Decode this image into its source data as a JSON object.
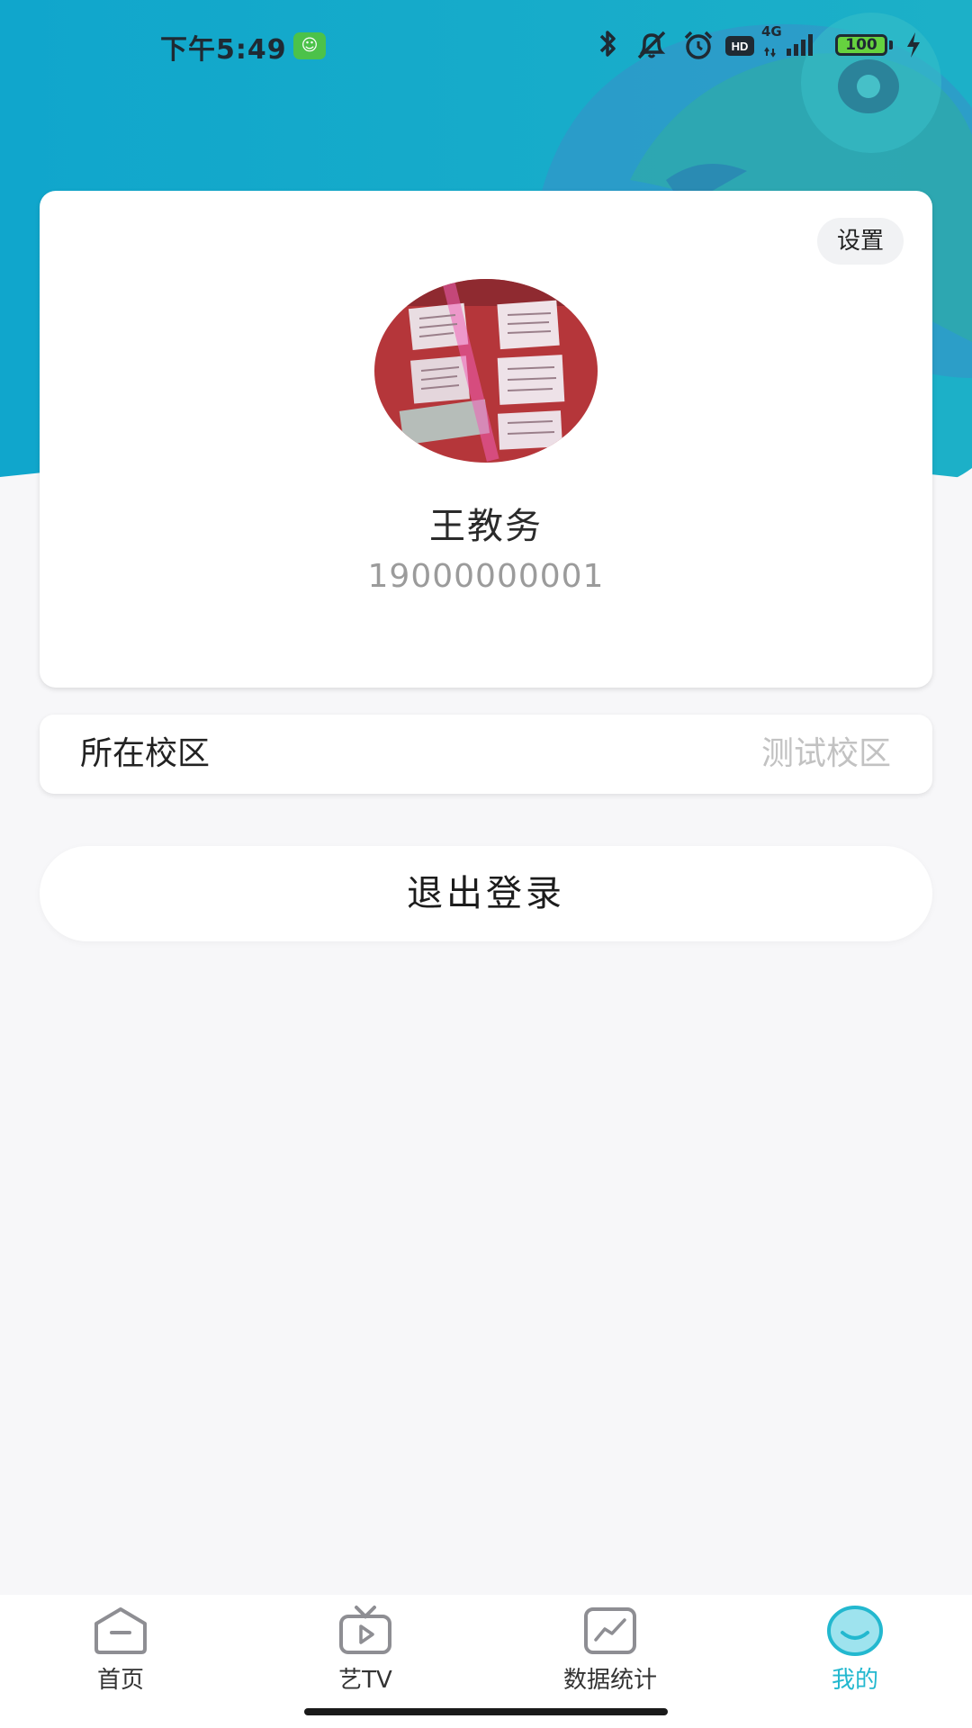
{
  "status_bar": {
    "time": "下午5:49",
    "network": "4G",
    "battery": "100"
  },
  "profile": {
    "settings_label": "设置",
    "name": "王教务",
    "phone": "19000000001"
  },
  "campus": {
    "label": "所在校区",
    "value": "测试校区"
  },
  "logout_label": "退出登录",
  "tabs": [
    {
      "label": "首页",
      "icon": "home-icon",
      "active": false
    },
    {
      "label": "艺TV",
      "icon": "tv-icon",
      "active": false
    },
    {
      "label": "数据统计",
      "icon": "stats-icon",
      "active": false
    },
    {
      "label": "我的",
      "icon": "profile-icon",
      "active": true
    }
  ],
  "colors": {
    "header_teal": "#1aa7c7",
    "accent": "#23b8cf",
    "page_background": "#f7f7f9"
  }
}
